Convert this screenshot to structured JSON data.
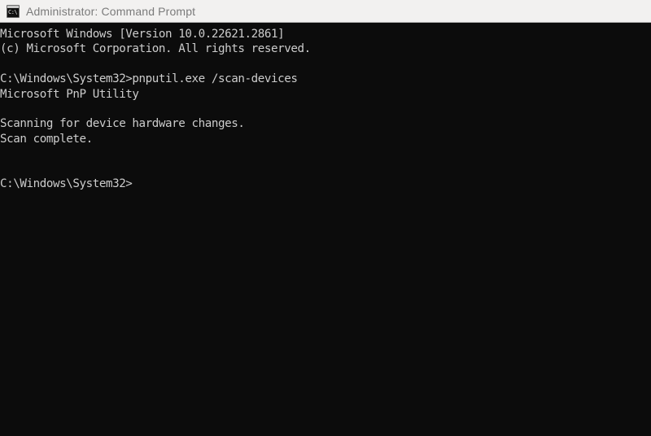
{
  "window": {
    "title": "Administrator: Command Prompt",
    "icon": "command-prompt-icon",
    "icon_glyph": "C:\\",
    "titlebar_bg": "#f2f1f0",
    "titlebar_text_color": "#7b7b7b",
    "console_bg": "#0c0c0c",
    "console_text_color": "#cccccc"
  },
  "console": {
    "lines": [
      "Microsoft Windows [Version 10.0.22621.2861]",
      "(c) Microsoft Corporation. All rights reserved.",
      "",
      "C:\\Windows\\System32>pnputil.exe /scan-devices",
      "Microsoft PnP Utility",
      "",
      "Scanning for device hardware changes.",
      "Scan complete.",
      "",
      "",
      "C:\\Windows\\System32>"
    ],
    "prompt": "C:\\Windows\\System32>",
    "command": "pnputil.exe /scan-devices",
    "os_version": "10.0.22621.2861",
    "copyright": "(c) Microsoft Corporation. All rights reserved.",
    "utility_name": "Microsoft PnP Utility",
    "status_messages": [
      "Scanning for device hardware changes.",
      "Scan complete."
    ]
  }
}
